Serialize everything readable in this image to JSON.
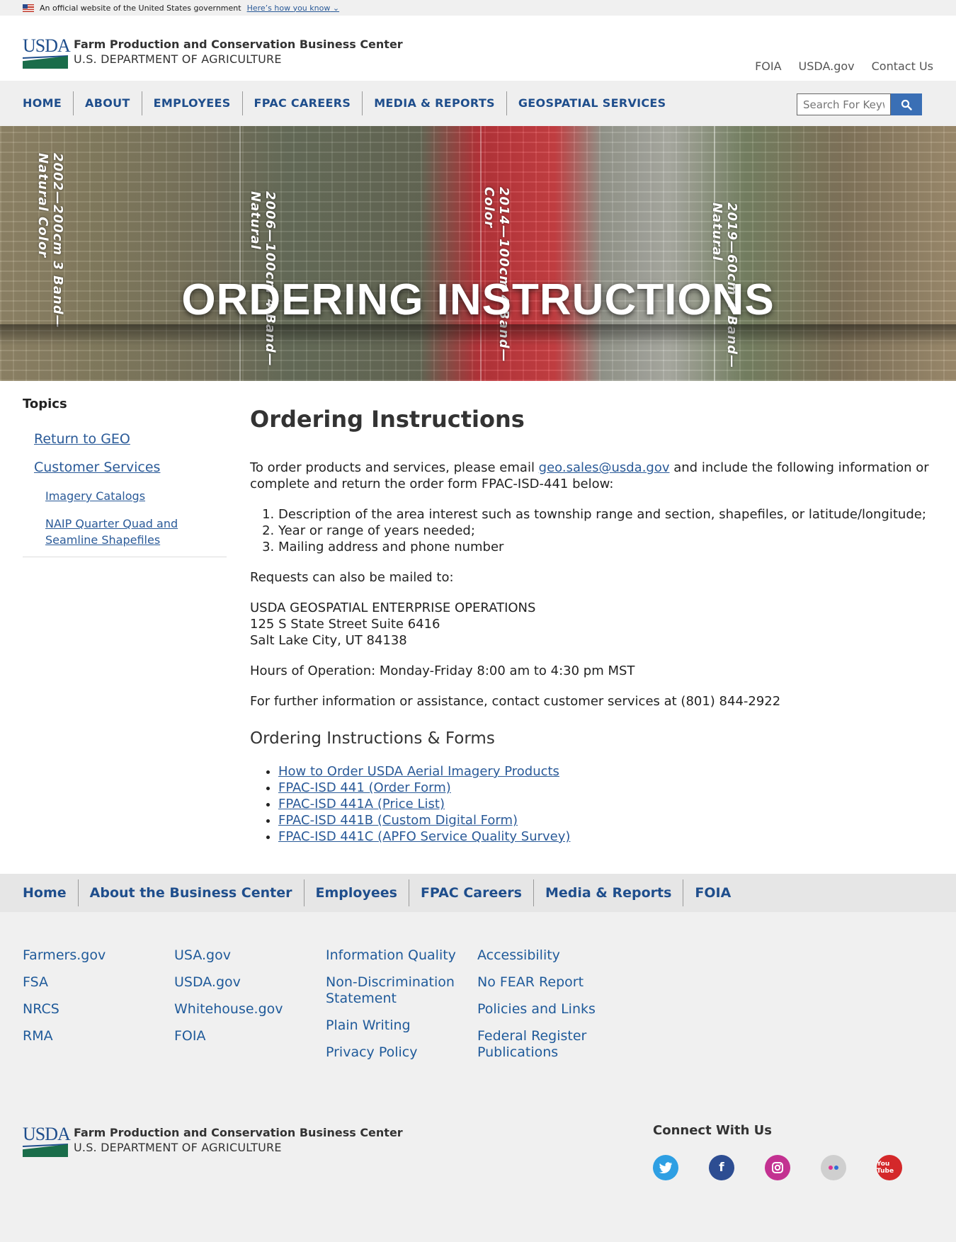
{
  "gov_banner": {
    "text": "An official website of the United States government",
    "link": "Here’s how you know"
  },
  "logo": {
    "mark": "USDA",
    "line1": "Farm Production and Conservation Business Center",
    "line2": "U.S. DEPARTMENT OF AGRICULTURE"
  },
  "util_links": [
    "FOIA",
    "USDA.gov",
    "Contact Us"
  ],
  "nav": [
    "HOME",
    "ABOUT",
    "EMPLOYEES",
    "FPAC CAREERS",
    "MEDIA & REPORTS",
    "GEOSPATIAL SERVICES"
  ],
  "search": {
    "placeholder": "Search For Keywords"
  },
  "hero": {
    "title": "ORDERING INSTRUCTIONS",
    "labels": [
      "2002—200cm 3 Band—Natural Color",
      "2006—100cm 4 Band—Natural",
      "2014—100cm 4 Band—Color",
      "2019—60cm 4 Band—Natural"
    ]
  },
  "sidebar": {
    "heading": "Topics",
    "items": [
      {
        "label": "Return to GEO",
        "level": 1
      },
      {
        "label": "Customer Services",
        "level": 1
      },
      {
        "label": "Imagery Catalogs",
        "level": 2
      },
      {
        "label": "NAIP Quarter Quad and Seamline Shapefiles",
        "level": 2
      }
    ]
  },
  "content": {
    "title": "Ordering Instructions",
    "intro_before": "To order products and services, please email ",
    "email": "geo.sales@usda.gov",
    "intro_after": " and include the following information or complete and return the order form FPAC-ISD-441 below:",
    "list": [
      "Description of the area interest such as township range and section, shapefiles, or latitude/longitude;",
      "Year or range of years needed;",
      "Mailing address and phone number"
    ],
    "mail_intro": "Requests can also be mailed to:",
    "address": [
      "USDA GEOSPATIAL ENTERPRISE OPERATIONS",
      "125 S State Street Suite 6416",
      "Salt Lake City, UT 84138"
    ],
    "hours": "Hours of Operation: Monday-Friday 8:00 am to 4:30 pm MST",
    "assist": "For further information or assistance, contact customer services at (801) 844-2922",
    "forms_heading": "Ordering Instructions & Forms",
    "forms": [
      "How to Order USDA Aerial Imagery Products",
      "FPAC-ISD 441 (Order Form)",
      "FPAC-ISD 441A (Price List)",
      "FPAC-ISD 441B (Custom Digital Form)",
      "FPAC-ISD 441C (APFO Service Quality Survey)"
    ]
  },
  "footer_nav": [
    "Home",
    "About the Business Center",
    "Employees",
    "FPAC Careers",
    "Media & Reports",
    "FOIA"
  ],
  "footer_cols": [
    [
      "Farmers.gov",
      "FSA",
      "NRCS",
      "RMA"
    ],
    [
      "USA.gov",
      "USDA.gov",
      "Whitehouse.gov",
      "FOIA"
    ],
    [
      "Information Quality",
      "Non-Discrimination Statement",
      "Plain Writing",
      "Privacy Policy"
    ],
    [
      "Accessibility",
      "No FEAR Report",
      "Policies and Links",
      "Federal Register Publications"
    ]
  ],
  "connect": {
    "heading": "Connect With Us",
    "icons": [
      "twitter-icon",
      "facebook-icon",
      "instagram-icon",
      "flickr-icon",
      "youtube-icon"
    ],
    "youtube_text": "You Tube"
  }
}
